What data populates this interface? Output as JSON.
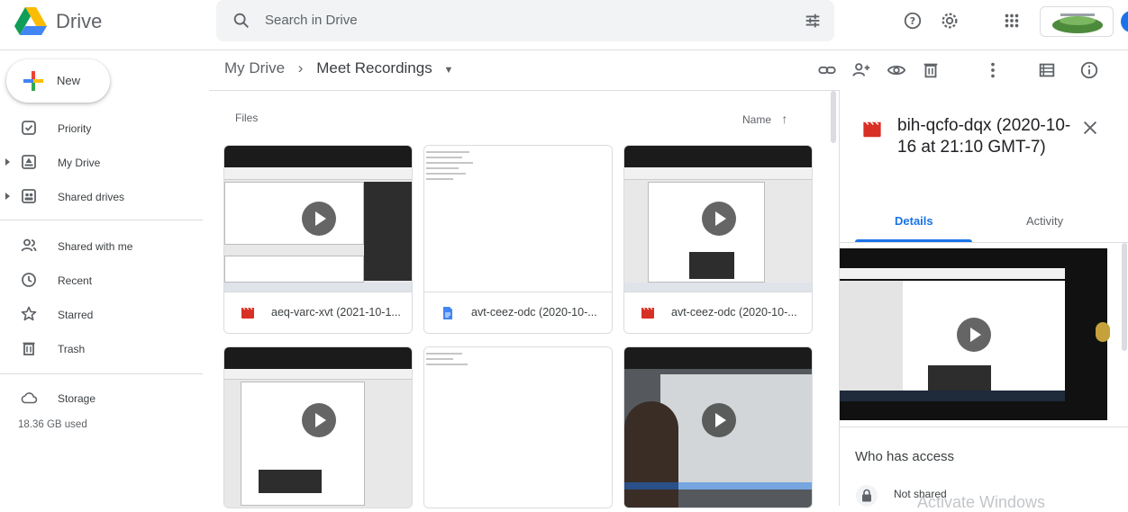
{
  "app": {
    "title": "Drive"
  },
  "search": {
    "placeholder": "Search in Drive"
  },
  "sidebar": {
    "new_label": "New",
    "items": [
      {
        "label": "Priority"
      },
      {
        "label": "My Drive"
      },
      {
        "label": "Shared drives"
      },
      {
        "label": "Shared with me"
      },
      {
        "label": "Recent"
      },
      {
        "label": "Starred"
      },
      {
        "label": "Trash"
      },
      {
        "label": "Storage"
      }
    ],
    "storage_used": "18.36 GB used"
  },
  "breadcrumb": {
    "root": "My Drive",
    "current": "Meet Recordings"
  },
  "files": {
    "section_label": "Files",
    "sort_label": "Name",
    "items": [
      {
        "name": "aeq-varc-xvt (2021-10-1...",
        "type": "video"
      },
      {
        "name": "avt-ceez-odc (2020-10-...",
        "type": "doc"
      },
      {
        "name": "avt-ceez-odc (2020-10-...",
        "type": "video"
      },
      {
        "name": "",
        "type": "video"
      },
      {
        "name": "",
        "type": "doc"
      },
      {
        "name": "",
        "type": "video"
      }
    ]
  },
  "details_panel": {
    "title": "bih-qcfo-dqx (2020-10-16 at 21:10 GMT-7)",
    "tabs": [
      "Details",
      "Activity"
    ],
    "who_has_access": "Who has access",
    "sharing_status": "Not shared"
  },
  "watermark": "Activate Windows",
  "colors": {
    "accent": "#1a73e8",
    "video_icon": "#d93025",
    "doc_icon": "#4285f4"
  }
}
